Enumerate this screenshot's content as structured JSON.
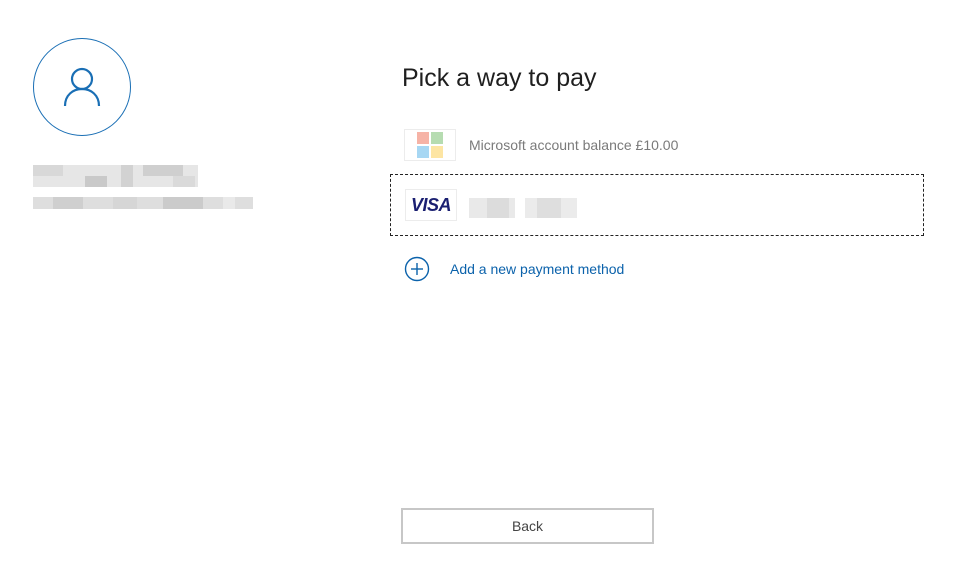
{
  "heading": "Pick a way to pay",
  "account": {
    "avatar_icon": "person-icon",
    "accent_color": "#1a6fb5"
  },
  "payment_options": [
    {
      "icon": "microsoft-logo-icon",
      "label": "Microsoft account balance £10.00"
    },
    {
      "icon": "visa-logo-icon",
      "brand": "VISA",
      "selected": true
    }
  ],
  "add_payment": {
    "icon": "plus-circle-icon",
    "label": "Add a new payment method",
    "color": "#0b62ab"
  },
  "back_button": "Back"
}
